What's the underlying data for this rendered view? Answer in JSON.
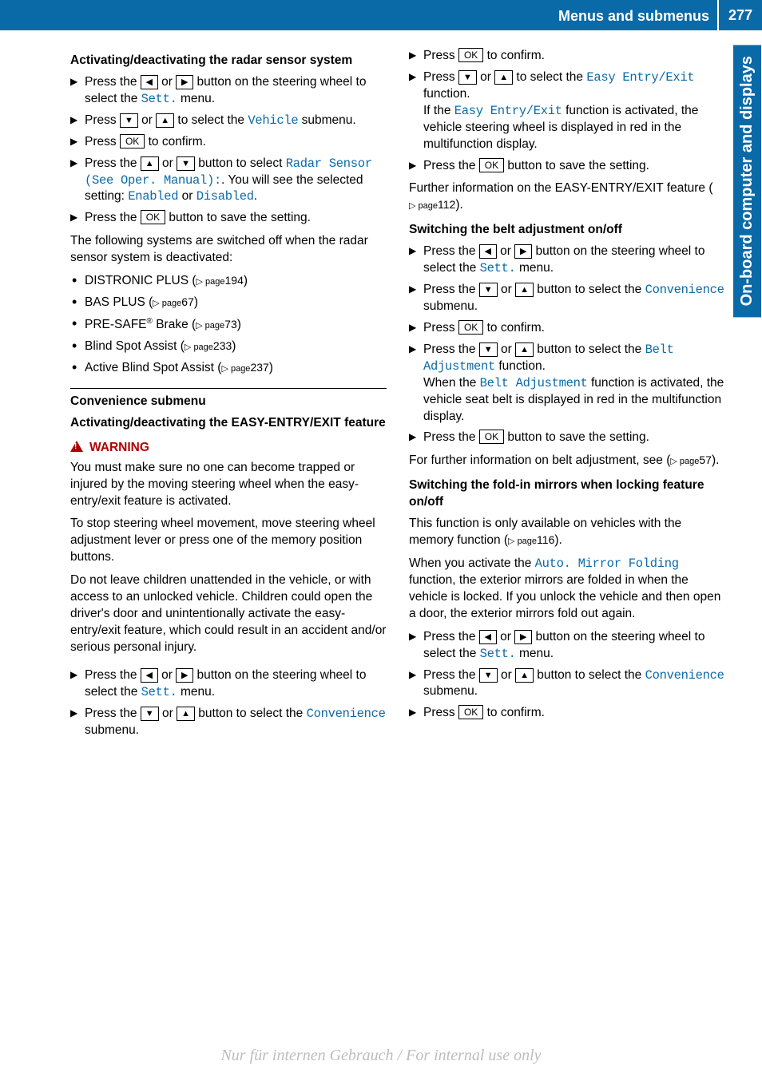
{
  "header": {
    "title": "Menus and submenus",
    "page": "277"
  },
  "sidetab": "On-board computer and displays",
  "buttons": {
    "left": "◀",
    "right": "▶",
    "up": "▲",
    "down": "▼",
    "ok": "OK"
  },
  "mono": {
    "sett": "Sett.",
    "vehicle": "Vehicle",
    "radar": "Radar Sensor (See Oper. Manual):",
    "enabled": "Enabled",
    "disabled": "Disabled",
    "convenience": "Convenience",
    "easy": "Easy Entry/Exit",
    "belt": "Belt Adjustment",
    "mirror": "Auto. Mirror Folding"
  },
  "left_col": {
    "h1": "Activating/deactivating the radar sensor system",
    "steps1": [
      {
        "pre": "Press the ",
        "b1": "left",
        "mid": " or ",
        "b2": "right",
        "post": " button on the steering wheel to select the ",
        "mono": "sett",
        "tail": " menu."
      },
      {
        "pre": "Press ",
        "b1": "down",
        "mid": " or ",
        "b2": "up",
        "post": " to select the ",
        "mono": "vehicle",
        "tail": " submenu."
      },
      {
        "pre": "Press ",
        "b1": "ok",
        "post": " to confirm."
      },
      {
        "pre": "Press the ",
        "b1": "up",
        "mid": " or ",
        "b2": "down",
        "post": " button to select ",
        "mono": "radar",
        "tail": ". You will see the selected setting: ",
        "mono2": "enabled",
        "mid2": " or ",
        "mono3": "disabled",
        "tail2": "."
      },
      {
        "pre": "Press the ",
        "b1": "ok",
        "post": " button to save the setting."
      }
    ],
    "p1": "The following systems are switched off when the radar sensor system is deactivated:",
    "bullets": [
      {
        "text": "DISTRONIC PLUS (",
        "page": "194",
        "tail": ")"
      },
      {
        "text": "BAS PLUS (",
        "page": "67",
        "tail": ")"
      },
      {
        "text": "PRE-SAFE",
        "sup": "®",
        "text2": " Brake (",
        "page": "73",
        "tail": ")"
      },
      {
        "text": "Blind Spot Assist (",
        "page": "233",
        "tail": ")"
      },
      {
        "text": "Active Blind Spot Assist (",
        "page": "237",
        "tail": ")"
      }
    ],
    "h2": "Convenience submenu",
    "h3": "Activating/deactivating the EASY-ENTRY/EXIT feature",
    "warn_label": "WARNING",
    "warn_p1": "You must make sure no one can become trapped or injured by the moving steering wheel when the easy-entry/exit feature is activated.",
    "warn_p2": "To stop steering wheel movement, move steering wheel adjustment lever or press one of the memory position buttons.",
    "warn_p3": "Do not leave children unattended in the vehicle, or with access to an unlocked vehicle. Children could open the driver's door and unintentionally activate the easy-entry/exit feature, which could result in an accident and/or serious personal injury.",
    "steps2": [
      {
        "pre": "Press the ",
        "b1": "left",
        "mid": " or ",
        "b2": "right",
        "post": " button on the steering wheel to select the ",
        "mono": "sett",
        "tail": " menu."
      },
      {
        "pre": "Press the ",
        "b1": "down",
        "mid": " or ",
        "b2": "up",
        "post": " button to select the ",
        "mono": "convenience",
        "tail": " submenu."
      }
    ]
  },
  "right_col": {
    "steps1": [
      {
        "pre": "Press ",
        "b1": "ok",
        "post": " to confirm."
      },
      {
        "pre": "Press ",
        "b1": "down",
        "mid": " or ",
        "b2": "up",
        "post": " to select the ",
        "mono": "easy",
        "tail": " function.",
        "extra": "If the ",
        "mono_e": "easy",
        "extra2": " function is activated, the vehicle steering wheel is displayed in red in the multifunction display."
      },
      {
        "pre": "Press the ",
        "b1": "ok",
        "post": " button to save the setting."
      }
    ],
    "p1a": "Further information on the EASY-ENTRY/EXIT feature (",
    "p1_page": "112",
    "p1b": ").",
    "h1": "Switching the belt adjustment on/off",
    "steps2": [
      {
        "pre": "Press the ",
        "b1": "left",
        "mid": " or ",
        "b2": "right",
        "post": " button on the steering wheel to select the ",
        "mono": "sett",
        "tail": " menu."
      },
      {
        "pre": "Press the ",
        "b1": "down",
        "mid": " or ",
        "b2": "up",
        "post": " button to select the ",
        "mono": "convenience",
        "tail": " submenu."
      },
      {
        "pre": "Press ",
        "b1": "ok",
        "post": " to confirm."
      },
      {
        "pre": "Press the ",
        "b1": "down",
        "mid": " or ",
        "b2": "up",
        "post": " button to select the ",
        "mono": "belt",
        "tail": " function.",
        "extra": "When the ",
        "mono_e": "belt",
        "extra2": " function is activated, the vehicle seat belt is displayed in red in the multifunction display."
      },
      {
        "pre": "Press the ",
        "b1": "ok",
        "post": " button to save the setting."
      }
    ],
    "p2a": "For further information on belt adjustment, see (",
    "p2_page": "57",
    "p2b": ").",
    "h2": "Switching the fold-in mirrors when locking feature on/off",
    "p3a": "This function is only available on vehicles with the memory function (",
    "p3_page": "116",
    "p3b": ").",
    "p4a": "When you activate the ",
    "p4b": " function, the exterior mirrors are folded in when the vehicle is locked. If you unlock the vehicle and then open a door, the exterior mirrors fold out again.",
    "steps3": [
      {
        "pre": "Press the ",
        "b1": "left",
        "mid": " or ",
        "b2": "right",
        "post": " button on the steering wheel to select the ",
        "mono": "sett",
        "tail": " menu."
      },
      {
        "pre": "Press the ",
        "b1": "down",
        "mid": " or ",
        "b2": "up",
        "post": " button to select the ",
        "mono": "convenience",
        "tail": " submenu."
      },
      {
        "pre": "Press ",
        "b1": "ok",
        "post": " to confirm."
      }
    ]
  },
  "watermark": "Nur für internen Gebrauch / For internal use only",
  "page_ref_prefix": "▷ page "
}
